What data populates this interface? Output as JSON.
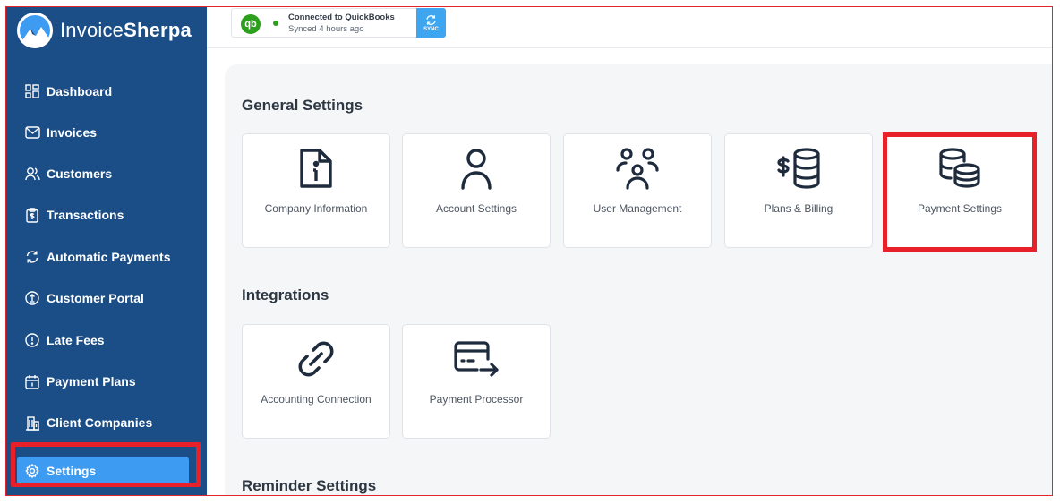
{
  "brand": {
    "name_regular": "Invoice",
    "name_bold": "Sherpa"
  },
  "sidebar": {
    "items": [
      {
        "label": "Dashboard",
        "icon": "dashboard-icon"
      },
      {
        "label": "Invoices",
        "icon": "mail-icon"
      },
      {
        "label": "Customers",
        "icon": "users-icon"
      },
      {
        "label": "Transactions",
        "icon": "clipboard-dollar-icon"
      },
      {
        "label": "Automatic Payments",
        "icon": "refresh-icon"
      },
      {
        "label": "Customer Portal",
        "icon": "portal-icon"
      },
      {
        "label": "Late Fees",
        "icon": "alert-circle-icon"
      },
      {
        "label": "Payment Plans",
        "icon": "calendar-icon"
      },
      {
        "label": "Client Companies",
        "icon": "building-icon"
      },
      {
        "label": "Settings",
        "icon": "gear-icon",
        "active": true
      }
    ]
  },
  "quickbooks": {
    "logo_text": "qb",
    "title": "Connected to QuickBooks",
    "subtitle": "Synced 4 hours ago",
    "sync_label": "SYNC"
  },
  "sections": {
    "general": {
      "title": "General Settings",
      "cards": [
        {
          "label": "Company Information",
          "icon": "document-info-icon"
        },
        {
          "label": "Account Settings",
          "icon": "user-icon"
        },
        {
          "label": "User Management",
          "icon": "user-group-icon"
        },
        {
          "label": "Plans & Billing",
          "icon": "dollar-coins-icon"
        },
        {
          "label": "Payment Settings",
          "icon": "coins-icon"
        }
      ]
    },
    "integrations": {
      "title": "Integrations",
      "cards": [
        {
          "label": "Accounting Connection",
          "icon": "link-icon"
        },
        {
          "label": "Payment Processor",
          "icon": "card-transfer-icon"
        }
      ]
    },
    "reminders": {
      "title": "Reminder Settings"
    }
  },
  "colors": {
    "sidebar_bg": "#1b4d86",
    "active_item": "#3e9bf2",
    "highlight": "#e8202a",
    "icon_dark": "#1e2b3c",
    "qb_green": "#2ca01c"
  }
}
